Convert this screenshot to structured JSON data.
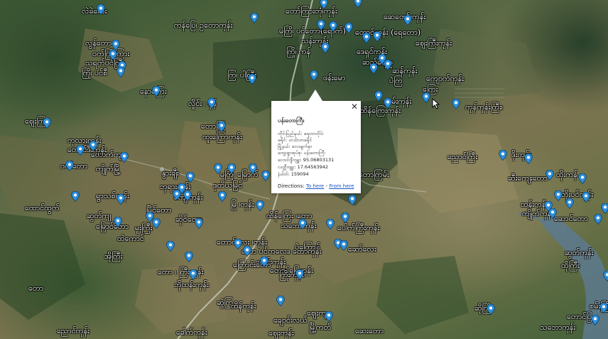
{
  "map": {
    "pin_color": "#2e8fd8",
    "road_color": "#cfd3c7",
    "river_color": "#5d7a8e"
  },
  "labels": [
    {
      "name": "label-01",
      "text": "လဲခဲလေး"
    },
    {
      "name": "label-02",
      "text": "ကန်ပြေ၊ ဥတောကုန်း"
    },
    {
      "name": "label-03",
      "text": "တော်ကြားတုံ၊ကုန်း"
    },
    {
      "name": "label-04",
      "text": "ဆေတော်းကုန်း"
    },
    {
      "name": "label-05",
      "text": "မကြိ၊ ပင်တော(ရောက်)"
    },
    {
      "name": "label-06",
      "text": "တောင်ကုန်း (ရေတော)"
    },
    {
      "name": "label-07",
      "text": "သန်းကုန်း"
    },
    {
      "name": "label-08",
      "text": "ဈေးကြီးကုန်း"
    },
    {
      "name": "label-09",
      "text": "ကြို၊ ကန်"
    },
    {
      "name": "label-10",
      "text": "ဒေရှင်ကုန်း"
    },
    {
      "name": "label-11",
      "text": "လွန်တော"
    },
    {
      "name": "label-12",
      "text": "ဝက်ကြီးကြား"
    },
    {
      "name": "label-13",
      "text": "သရက်ပင်ကြီး"
    },
    {
      "name": "label-14",
      "text": "ကြို၊ ပင်စီ"
    },
    {
      "name": "label-15",
      "text": "ကြ၊ ပါကြီး"
    },
    {
      "name": "label-16",
      "text": "ဆည်ရေ ဥ"
    },
    {
      "name": "label-17",
      "text": "ဆန်ကုန်း"
    },
    {
      "name": "label-18",
      "text": "ဖန်းမော"
    },
    {
      "name": "label-19",
      "text": "ပဲကြ"
    },
    {
      "name": "label-20",
      "text": "နောကြေး"
    },
    {
      "name": "label-21",
      "text": "လှိုင်း ၊ ပုန်"
    },
    {
      "name": "label-22",
      "text": "ကုန်ကုန်းကြီး၊"
    },
    {
      "name": "label-23",
      "text": "စမ်းကုန်း"
    },
    {
      "name": "label-24",
      "text": "ထိန်ကြေးကုန်း"
    },
    {
      "name": "label-25",
      "text": "ဈေးကြ"
    },
    {
      "name": "label-26",
      "text": "တောကြ"
    },
    {
      "name": "label-27",
      "text": "ကုလားကုန်း"
    },
    {
      "name": "label-28",
      "text": "ထူးကြောကုန်း"
    },
    {
      "name": "label-29",
      "text": "ထောက်ကျ"
    },
    {
      "name": "label-30",
      "text": "တောင်ဒီးကုန်း"
    },
    {
      "name": "label-31",
      "text": "ညောင်ကြီး"
    },
    {
      "name": "label-32",
      "text": "ဒိုးကုန်း"
    },
    {
      "name": "label-33",
      "text": "ဝက်တော"
    },
    {
      "name": "label-34",
      "text": "ကျိုက်မြို့"
    },
    {
      "name": "label-35",
      "text": "နွားချီး"
    },
    {
      "name": "label-36",
      "text": "မကြို၊ မြောက်"
    },
    {
      "name": "label-37",
      "text": "တောကြမ်း"
    },
    {
      "name": "label-38",
      "text": "ဆီးကျေးတော"
    },
    {
      "name": "label-39",
      "text": "ဘုရားကုန်း"
    },
    {
      "name": "label-40",
      "text": "ထိုးကန်"
    },
    {
      "name": "label-41",
      "text": "ဒုတိယမြင်"
    },
    {
      "name": "label-42",
      "text": "ဘိုးပင်ကုန်း"
    },
    {
      "name": "label-43",
      "text": "ရွာသစ်ကုန်း"
    },
    {
      "name": "label-44",
      "text": "ကျေးကုန်း"
    },
    {
      "name": "label-45",
      "text": "ထောင်ထွက်"
    },
    {
      "name": "label-46",
      "text": "မြ ၊ကုန်း"
    },
    {
      "name": "label-47",
      "text": "ထန်းကုန်း"
    },
    {
      "name": "label-48",
      "text": "မြိုင်တော"
    },
    {
      "name": "label-49",
      "text": "ထိန်ကြေး ၊တော"
    },
    {
      "name": "label-50",
      "text": "ဆွတ်ကျ"
    },
    {
      "name": "label-51",
      "text": "ကျိုက်ကုန်း"
    },
    {
      "name": "label-52",
      "text": "ဆောင်တော"
    },
    {
      "name": "label-53",
      "text": "ဆိုင်တော"
    },
    {
      "name": "label-54",
      "text": "မြောင်တော"
    },
    {
      "name": "label-55",
      "text": "မူးကြီး"
    },
    {
      "name": "label-56",
      "text": "သဘောကုန်း"
    },
    {
      "name": "label-57",
      "text": "ပေါက်ကြီးကုန်း"
    },
    {
      "name": "label-58",
      "text": "တောင်လေး ၊ကုန်း"
    },
    {
      "name": "label-59",
      "text": "ပဲကြောင်"
    },
    {
      "name": "label-60",
      "text": "ဆော်လေး"
    },
    {
      "name": "label-61",
      "text": "တော ပင်ကလေး၊ တောကုန်း"
    },
    {
      "name": "label-62",
      "text": "အိုကြီး"
    },
    {
      "name": "label-63",
      "text": "ပေါင်းကုန်း"
    },
    {
      "name": "label-64",
      "text": "ဆွတ်ကုန်း"
    },
    {
      "name": "label-65",
      "text": "ထိုကြီး"
    },
    {
      "name": "label-66",
      "text": "ကြောင်းတော"
    },
    {
      "name": "label-67",
      "text": "တောင်ပြေကုန်း"
    },
    {
      "name": "label-68",
      "text": "တော ၊ ကြီးကုန်း"
    },
    {
      "name": "label-69",
      "text": "ကြိုးကုန်း"
    },
    {
      "name": "label-70",
      "text": "ဘိုထန်းကုန်း"
    },
    {
      "name": "label-71",
      "text": "ဆွဲကြ"
    },
    {
      "name": "label-72",
      "text": "ဆိုကြီး"
    },
    {
      "name": "label-73",
      "text": "စမ်းကြီး"
    },
    {
      "name": "label-74",
      "text": "ထိန်ကုန်း"
    },
    {
      "name": "label-75",
      "text": "ဈေးကျ"
    },
    {
      "name": "label-76",
      "text": "တောင်ပြ"
    },
    {
      "name": "label-77",
      "text": "ချောင်းလယ်"
    },
    {
      "name": "label-78",
      "text": "ညောင်ကုန်း"
    },
    {
      "name": "label-79",
      "text": "ခေါက်ကုန်း"
    },
    {
      "name": "label-80",
      "text": "ဈေးကုန်း"
    },
    {
      "name": "label-81",
      "text": "မြို့ကတ်"
    },
    {
      "name": "label-82",
      "text": "ဆေးတော"
    },
    {
      "name": "label-83",
      "text": "ကျောက်ကုန်း"
    },
    {
      "name": "label-84",
      "text": "ကြေး"
    },
    {
      "name": "label-85",
      "text": "သဘောကုန်း"
    },
    {
      "name": "label-86",
      "text": "ထဲကောင်"
    },
    {
      "name": "label-87",
      "text": "တော"
    }
  ],
  "popup": {
    "title": "ပန်းတောကြီး",
    "rows": [
      "တိုင်းပြည်နယ်: ရေတာတိုင်း",
      "ခရိုင်: ဟင်္သာတခရိုင်",
      "မြို့နယ်: လေးမျက်နှာ",
      "ကျေးရွာအုပ်စု: ပန်းတောကြီး",
      "လောင်ဂျီကျူး: 95.06803131",
      "လတ္တီကျူး: 17.64563942",
      "နံပါတ်: 159094"
    ],
    "directions_label": "Directions:",
    "to_here": "To here",
    "separator": " - ",
    "from_here": "From here",
    "close_glyph": "✕"
  }
}
